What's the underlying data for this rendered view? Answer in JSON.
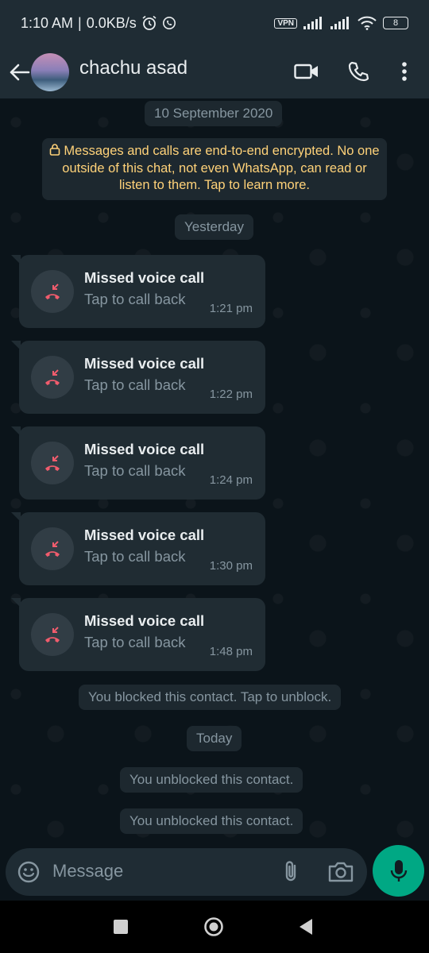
{
  "status_bar": {
    "time": "1:10 AM",
    "speed": "0.0KB/s",
    "separator": "|",
    "vpn_label": "VPN",
    "battery": "8",
    "icons": [
      "alarm-icon",
      "whatsapp-icon",
      "signal-icon",
      "signal-icon",
      "wifi-icon",
      "battery-icon"
    ]
  },
  "header": {
    "contact_name": "chachu asad",
    "icons": [
      "back-arrow-icon",
      "video-call-icon",
      "voice-call-icon",
      "more-options-icon"
    ]
  },
  "chat": {
    "date_first": "10 September 2020",
    "encryption_notice": "Messages and calls are end-to-end encrypted. No one outside of this chat, not even WhatsApp, can read or listen to them. Tap to learn more.",
    "date_yesterday": "Yesterday",
    "calls": [
      {
        "title": "Missed voice call",
        "subtitle": "Tap to call back",
        "time": "1:21 pm"
      },
      {
        "title": "Missed voice call",
        "subtitle": "Tap to call back",
        "time": "1:22 pm"
      },
      {
        "title": "Missed voice call",
        "subtitle": "Tap to call back",
        "time": "1:24 pm"
      },
      {
        "title": "Missed voice call",
        "subtitle": "Tap to call back",
        "time": "1:30 pm"
      },
      {
        "title": "Missed voice call",
        "subtitle": "Tap to call back",
        "time": "1:48 pm"
      }
    ],
    "blocked_notice": "You blocked this contact. Tap to unblock.",
    "date_today": "Today",
    "unblocked_notices": [
      "You unblocked this contact.",
      "You unblocked this contact."
    ]
  },
  "composer": {
    "placeholder": "Message",
    "icons": [
      "emoji-icon",
      "attach-icon",
      "camera-icon",
      "mic-icon"
    ]
  },
  "colors": {
    "header_bg": "#1f2c34",
    "chat_bg": "#0b141a",
    "bubble_bg": "#202c33",
    "encryption_text": "#ffd279",
    "missed_call_red": "#f15c6d",
    "accent_green": "#00a884"
  }
}
